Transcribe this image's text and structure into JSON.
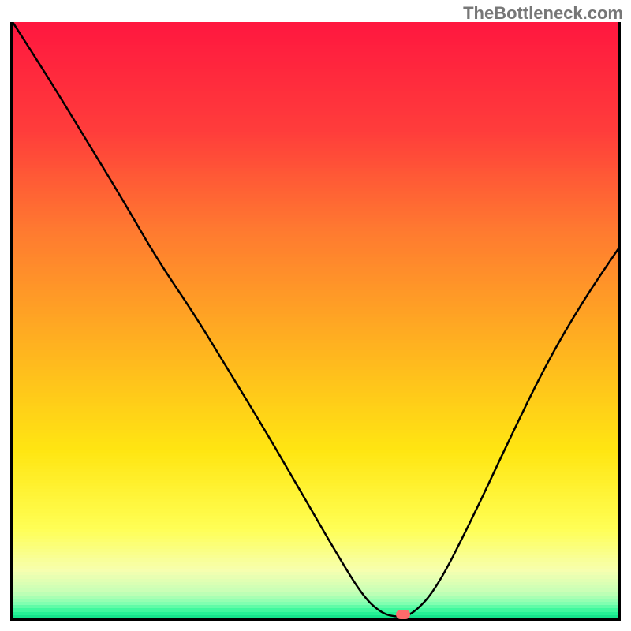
{
  "watermark": "TheBottleneck.com",
  "chart_data": {
    "type": "line",
    "title": "",
    "xlabel": "",
    "ylabel": "",
    "xlim": [
      0,
      100
    ],
    "ylim": [
      0,
      100
    ],
    "grid": false,
    "legend": false,
    "background": {
      "description": "Vertical gradient fill behind the curve, top red through orange/yellow to thin green band at bottom",
      "stops": [
        {
          "y_pct": 0.0,
          "color": "#ff173f"
        },
        {
          "y_pct": 0.18,
          "color": "#ff3c3b"
        },
        {
          "y_pct": 0.35,
          "color": "#ff7a30"
        },
        {
          "y_pct": 0.55,
          "color": "#ffb41f"
        },
        {
          "y_pct": 0.72,
          "color": "#ffe612"
        },
        {
          "y_pct": 0.85,
          "color": "#ffff55"
        },
        {
          "y_pct": 0.92,
          "color": "#f6ffb0"
        },
        {
          "y_pct": 0.955,
          "color": "#c8ffb6"
        },
        {
          "y_pct": 0.975,
          "color": "#80ffb0"
        },
        {
          "y_pct": 0.99,
          "color": "#2af598"
        },
        {
          "y_pct": 1.0,
          "color": "#0edd87"
        }
      ]
    },
    "series": [
      {
        "name": "bottleneck-curve",
        "color": "#000000",
        "x": [
          0.0,
          6,
          12,
          18,
          24,
          30,
          36,
          42,
          48,
          54,
          58,
          61,
          63.5,
          66,
          70,
          76,
          82,
          88,
          94,
          100
        ],
        "y": [
          100,
          90.5,
          80.5,
          70.5,
          60,
          51,
          41,
          31,
          20.5,
          10,
          3.5,
          0.8,
          0.2,
          0.6,
          5,
          17,
          30,
          42.5,
          53,
          62
        ]
      }
    ],
    "marker": {
      "x": 64.5,
      "y": 0.6,
      "color": "#ff6b6b",
      "shape": "rounded-rect"
    }
  }
}
